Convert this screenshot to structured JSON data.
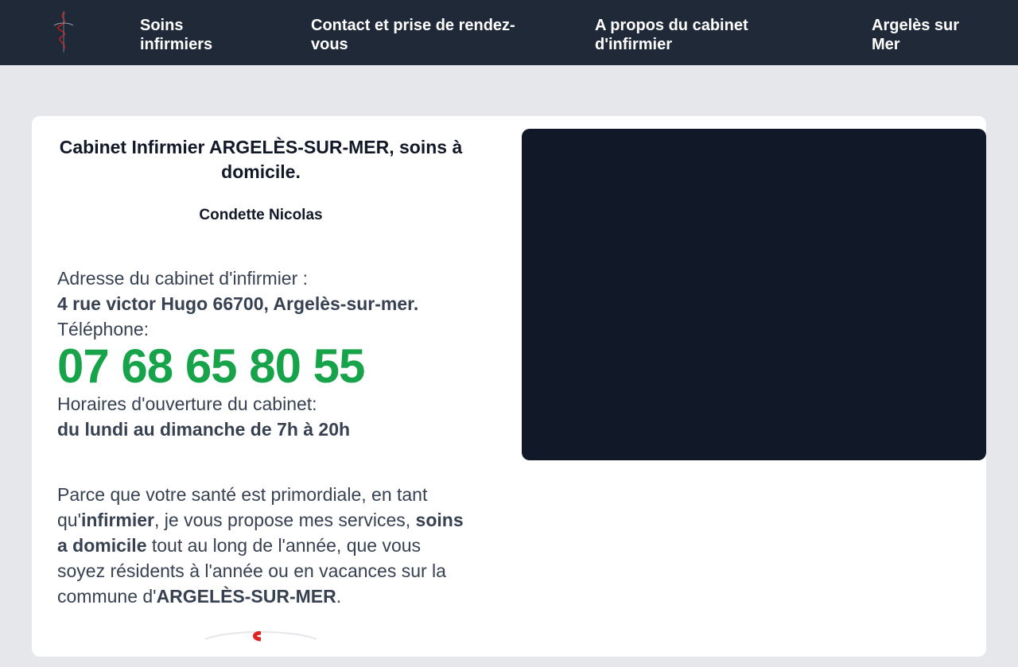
{
  "nav": {
    "logo_icon": "caduceus-logo-icon",
    "items": [
      {
        "label": "Soins infirmiers"
      },
      {
        "label": "Contact et prise de rendez-vous"
      },
      {
        "label": "A propos du cabinet d'infirmier"
      },
      {
        "label": "Argelès sur Mer"
      }
    ]
  },
  "main": {
    "title": "Cabinet Infirmier ARGELÈS-SUR-MER, soins à domicile.",
    "subtitle": "Condette Nicolas",
    "address_label": "Adresse du cabinet d'infirmier :",
    "address_value": "4 rue victor Hugo 66700, Argelès-sur-mer.",
    "phone_label": "Téléphone:",
    "phone_value": "07 68 65 80 55",
    "hours_label": "Horaires d'ouverture du cabinet:",
    "hours_value": "du lundi au dimanche de 7h à 20h",
    "intro": {
      "p1": "Parce que votre santé est primordiale, en tant qu'",
      "b1": "infirmier",
      "p2": ", je vous propose mes services, ",
      "b2": "soins a domicile",
      "p3": " tout au long de l'année, que vous soyez résidents à l'année ou en vacances sur la commune d'",
      "b3": "ARGELÈS-SUR-MER",
      "p4": "."
    }
  },
  "colors": {
    "nav_bg": "#1f2937",
    "page_bg": "#e5e7eb",
    "phone_green": "#16a34a",
    "media_bg": "#111827",
    "logo_red": "#b91c1c"
  }
}
